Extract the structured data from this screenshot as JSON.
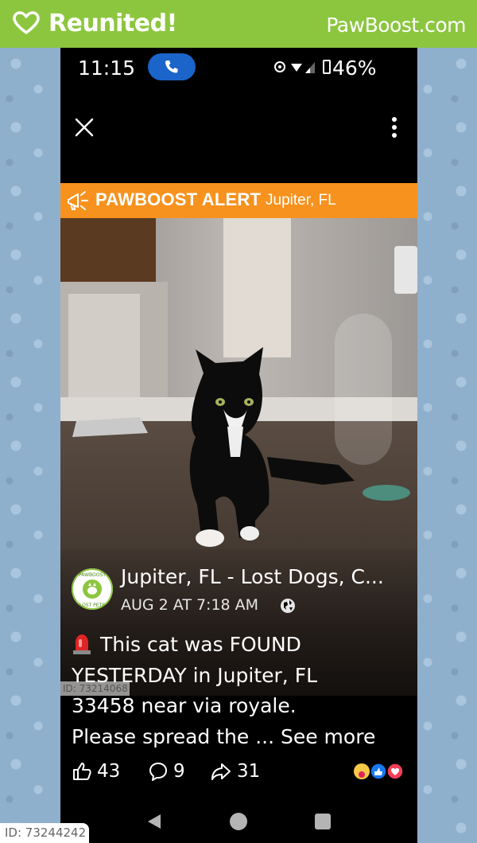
{
  "banner": {
    "status": "Reunited!",
    "brand": "PawBoost.com",
    "color": "#8cc63f"
  },
  "status_bar": {
    "time": "11:15",
    "battery": "46%"
  },
  "alert": {
    "title": "PAWBOOST ALERT",
    "location": "Jupiter, FL",
    "color": "#f7921e"
  },
  "post": {
    "group": "Jupiter, FL - Lost Dogs, C...",
    "date": "AUG 2 AT 7:18 AM",
    "text_lines": [
      "This cat was FOUND",
      "YESTERDAY in Jupiter, FL",
      "33458 near via royale.",
      "Please spread the ..."
    ],
    "see_more": "See more",
    "likes": "43",
    "comments": "9",
    "shares": "31"
  },
  "avatar_text": {
    "top": "PAWBOOST",
    "bottom": "LOST PETS"
  },
  "ids": {
    "inner": "ID: 73214068",
    "outer": "ID: 73244242"
  },
  "icons": [
    "heart-icon",
    "phone-call-icon",
    "close-icon",
    "more-vertical-icon",
    "megaphone-icon",
    "globe-icon",
    "siren-icon",
    "like-icon",
    "comment-icon",
    "share-icon",
    "back-icon",
    "home-icon",
    "recents-icon"
  ]
}
